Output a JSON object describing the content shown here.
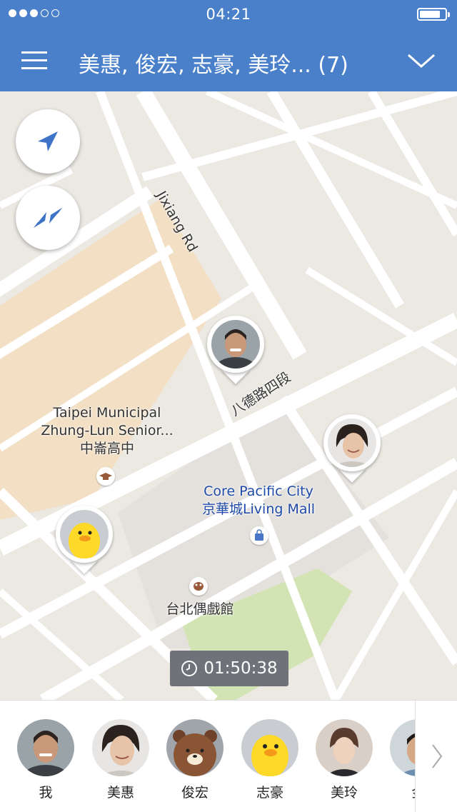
{
  "status": {
    "time": "04:21",
    "signal_dots": 5,
    "signal_filled": 3
  },
  "header": {
    "title": "美惠, 俊宏, 志豪, 美玲... (7)"
  },
  "map": {
    "labels": {
      "road1": "Jixiang Rd",
      "road2": "八德路四段",
      "school_line1": "Taipei Municipal",
      "school_line2": "Zhung-Lun Senior...",
      "school_line3": "中崙高中",
      "mall_line1": "Core Pacific City",
      "mall_line2": "京華城Living Mall",
      "theater": "台北偶戲館"
    },
    "timer": "01:50:38"
  },
  "friends": [
    {
      "name": "我",
      "avatar": "man-avatar"
    },
    {
      "name": "美惠",
      "avatar": "woman-avatar"
    },
    {
      "name": "俊宏",
      "avatar": "brown-bear-avatar"
    },
    {
      "name": "志豪",
      "avatar": "sally-chick-avatar"
    },
    {
      "name": "美玲",
      "avatar": "woman-avatar"
    },
    {
      "name": "金",
      "avatar": "man-avatar"
    }
  ],
  "colors": {
    "header": "#4a80c9",
    "accent": "#3e74c8"
  }
}
